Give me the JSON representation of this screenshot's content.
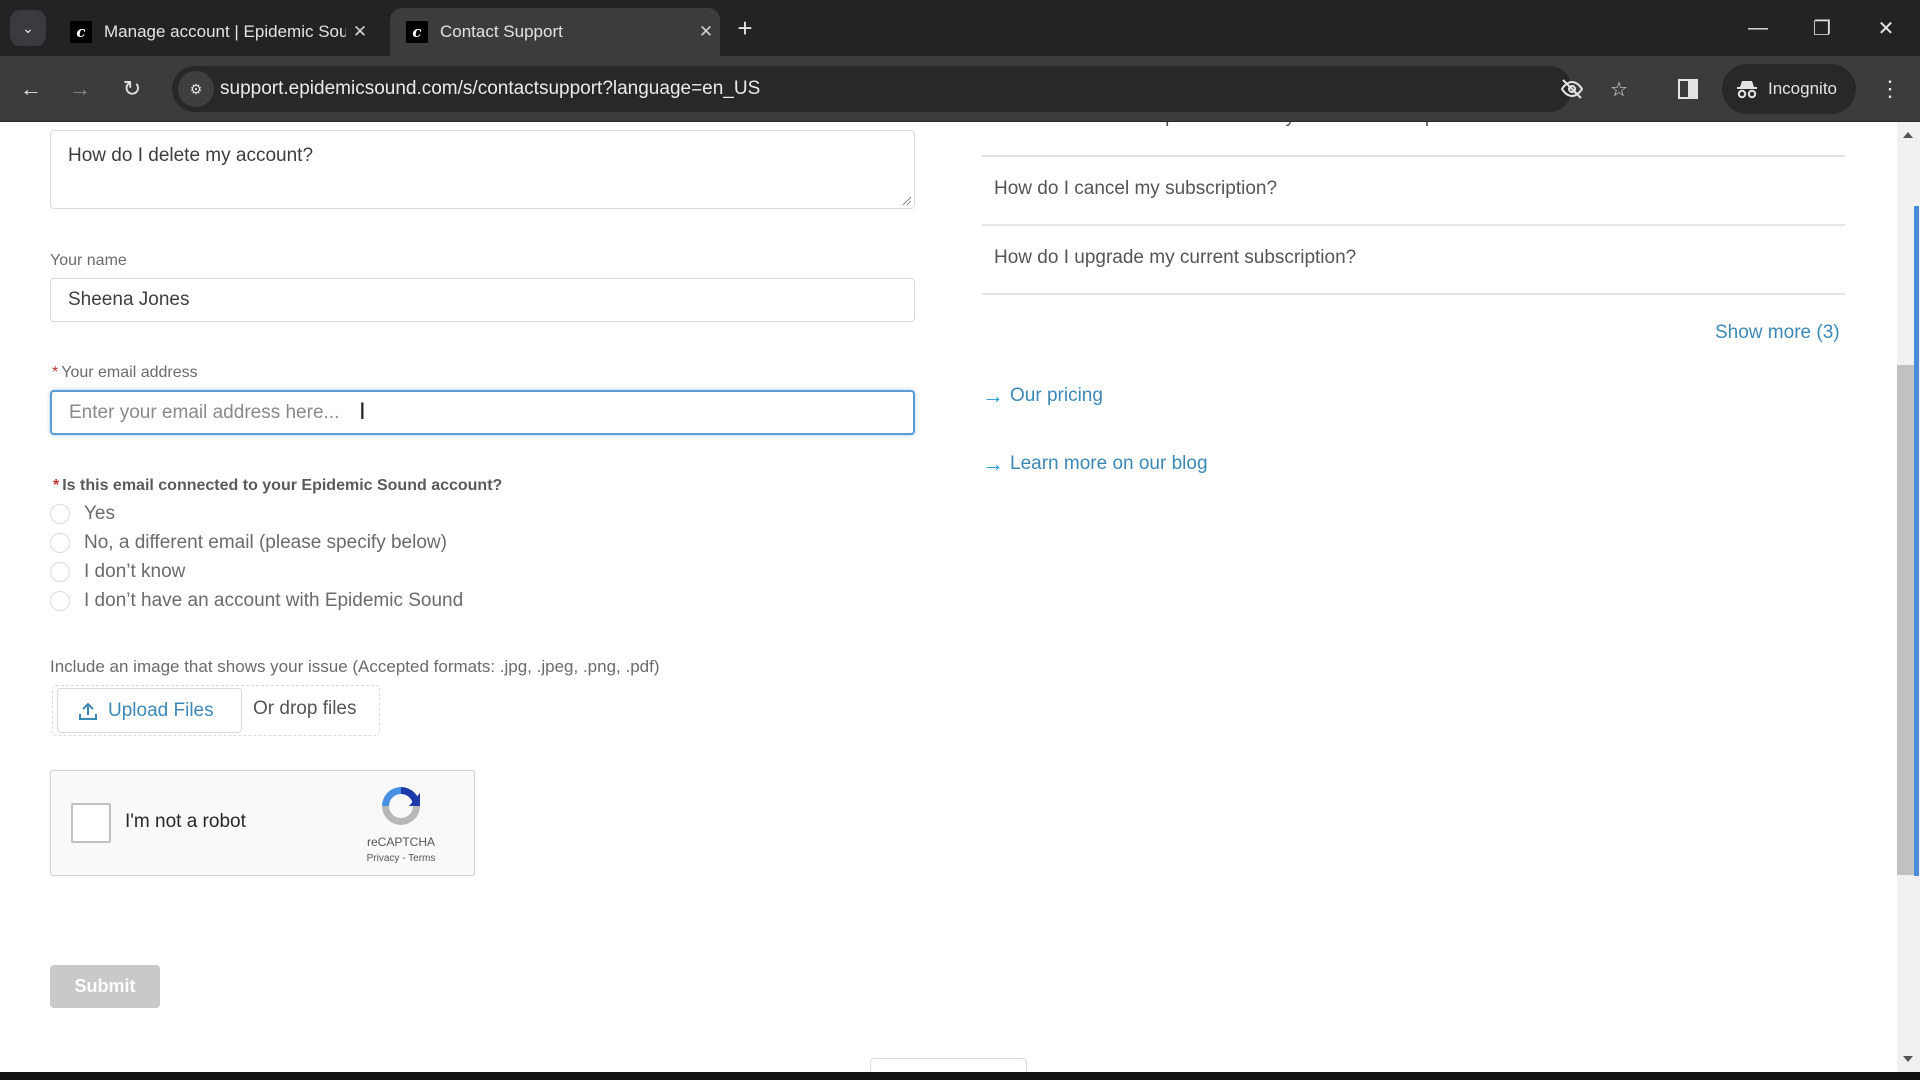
{
  "browser": {
    "tabs": [
      {
        "title": "Manage account | Epidemic Sou",
        "favicon": "epidemic-sound-logo",
        "active": false
      },
      {
        "title": "Contact Support",
        "favicon": "epidemic-sound-logo",
        "active": true
      }
    ],
    "url": "support.epidemicsound.com/s/contactsupport?language=en_US",
    "profile_label": "Incognito",
    "icons": {
      "tab_list": "chevron-down-icon",
      "new_tab": "plus-icon",
      "back": "arrow-left-icon",
      "forward": "arrow-right-icon",
      "reload": "reload-icon",
      "site_info": "tune-icon",
      "tracking": "eye-off-icon",
      "bookmark": "star-icon",
      "side_panel": "side-panel-icon",
      "menu": "kebab-menu-icon"
    },
    "glyphs": {
      "tab_list": "⌄",
      "close": "✕",
      "new_tab": "+",
      "back": "←",
      "forward": "→",
      "reload": "↻",
      "site_info": "⚙",
      "bookmark": "☆",
      "menu": "⋮",
      "minimize": "—",
      "restore": "❐",
      "close_window": "✕",
      "favicon": "c"
    }
  },
  "form": {
    "description_value": "How do I delete my account?",
    "name_label": "Your name",
    "name_value": "Sheena Jones",
    "email_required_mark": "*",
    "email_label": "Your email address",
    "email_placeholder": "Enter your email address here...",
    "email_value": "",
    "connected_required_mark": "*",
    "connected_question": "Is this email connected to your Epidemic Sound account?",
    "connected_options": [
      {
        "label": "Yes",
        "selected": false
      },
      {
        "label": "No, a different email (please specify below)",
        "selected": false
      },
      {
        "label": "I don’t know",
        "selected": false
      },
      {
        "label": "I don’t have an account with Epidemic Sound",
        "selected": false
      }
    ],
    "upload_label": "Include an image that shows your issue (Accepted formats: .jpg, .jpeg, .png, .pdf)",
    "upload_button": "Upload Files",
    "drop_text": "Or drop files",
    "captcha": {
      "label": "I'm not a robot",
      "brand": "reCAPTCHA",
      "privacy": "Privacy",
      "separator": " - ",
      "terms": "Terms",
      "checked": false
    },
    "submit_label": "Submit"
  },
  "sidebar": {
    "faq_items": [
      "How do I add social platforms to my current subscription?",
      "How do I cancel my subscription?",
      "How do I upgrade my current subscription?"
    ],
    "show_more": "Show more (3)",
    "links": [
      {
        "label": "Our pricing",
        "icon": "arrow-right-icon"
      },
      {
        "label": "Learn more on our blog",
        "icon": "arrow-right-icon"
      }
    ]
  },
  "colors": {
    "link": "#3d89b5",
    "focus": "#5b9bd5",
    "required": "#c23934",
    "submit_disabled": "#c9c9c9"
  }
}
